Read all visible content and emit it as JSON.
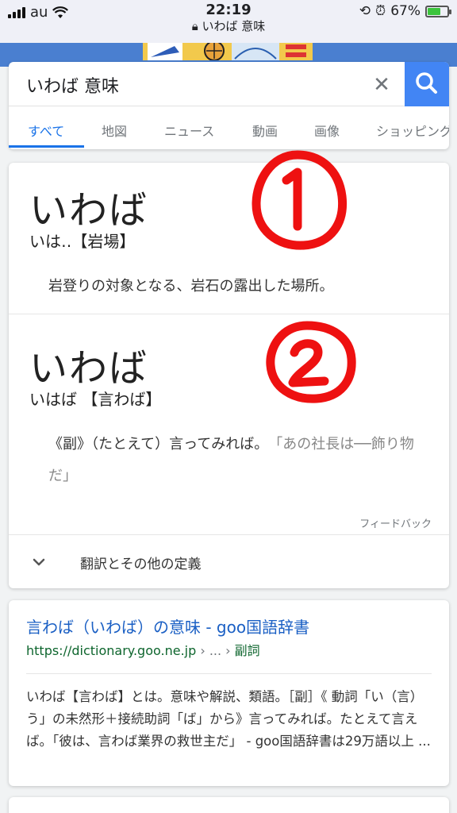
{
  "status_bar": {
    "carrier": "au",
    "time": "22:19",
    "url": "いわば 意味",
    "battery": "67%",
    "battery_level": 0.67
  },
  "search": {
    "query": "いわば 意味",
    "clear_label": "✕",
    "tabs": [
      "すべて",
      "地図",
      "ニュース",
      "動画",
      "画像",
      "ショッピング"
    ],
    "active_tab": 0
  },
  "dictionary": {
    "entries": [
      {
        "word": "いわば",
        "reading": "いは‥【岩場】",
        "definition": "岩登りの対象となる、岩石の露出した場所。",
        "example": ""
      },
      {
        "word": "いわば",
        "reading": "いはば 【言わば】",
        "definition": "《副》（たとえて）言ってみれば。",
        "example": "「あの社長は──飾り物だ」"
      }
    ],
    "feedback_label": "フィードバック",
    "more_label": "翻訳とその他の定義"
  },
  "result": {
    "title": "言わば（いわば）の意味 - goo国語辞書",
    "url": "https://dictionary.goo.ne.jp",
    "url_sep": " › ... › ",
    "url_crumb": "副詞",
    "snippet": "いわば【言わば】とは。意味や解説、類語。［副］《 動詞「い（言）う」の未然形＋接続助詞「ば」から》言ってみれば。たとえて言えば。「彼は、言わば業界の救世主だ」 - goo国語辞書は29万語以上 ..."
  },
  "colors": {
    "link": "#1a5fc4",
    "accent": "#4285f4",
    "url_green": "#0d652d",
    "annotation_red": "#ee1111"
  }
}
